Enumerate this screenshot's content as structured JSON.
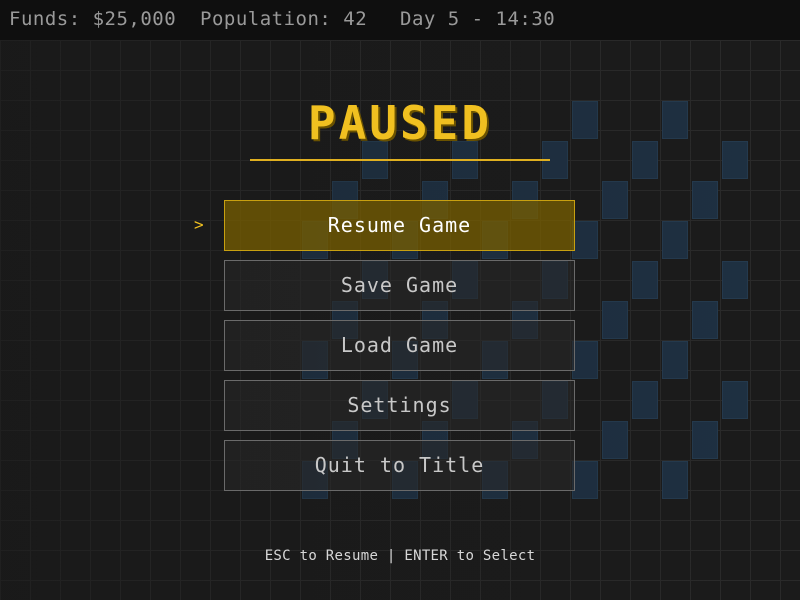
{
  "hud": {
    "funds": "Funds: $25,000",
    "population": "Population: 42",
    "day_time": "Day 5 - 14:30"
  },
  "pause_menu": {
    "title": "PAUSED",
    "cursor_glyph": ">",
    "items": [
      {
        "label": "Resume Game",
        "selected": true
      },
      {
        "label": "Save Game",
        "selected": false
      },
      {
        "label": "Load Game",
        "selected": false
      },
      {
        "label": "Settings",
        "selected": false
      },
      {
        "label": "Quit to Title",
        "selected": false
      }
    ],
    "hint": "ESC to Resume | ENTER to Select"
  },
  "colors": {
    "accent": "#f0c020",
    "selected_bg": "#785f00",
    "tile_blue": "#1e3042",
    "hud_text": "#9a9a9a"
  }
}
